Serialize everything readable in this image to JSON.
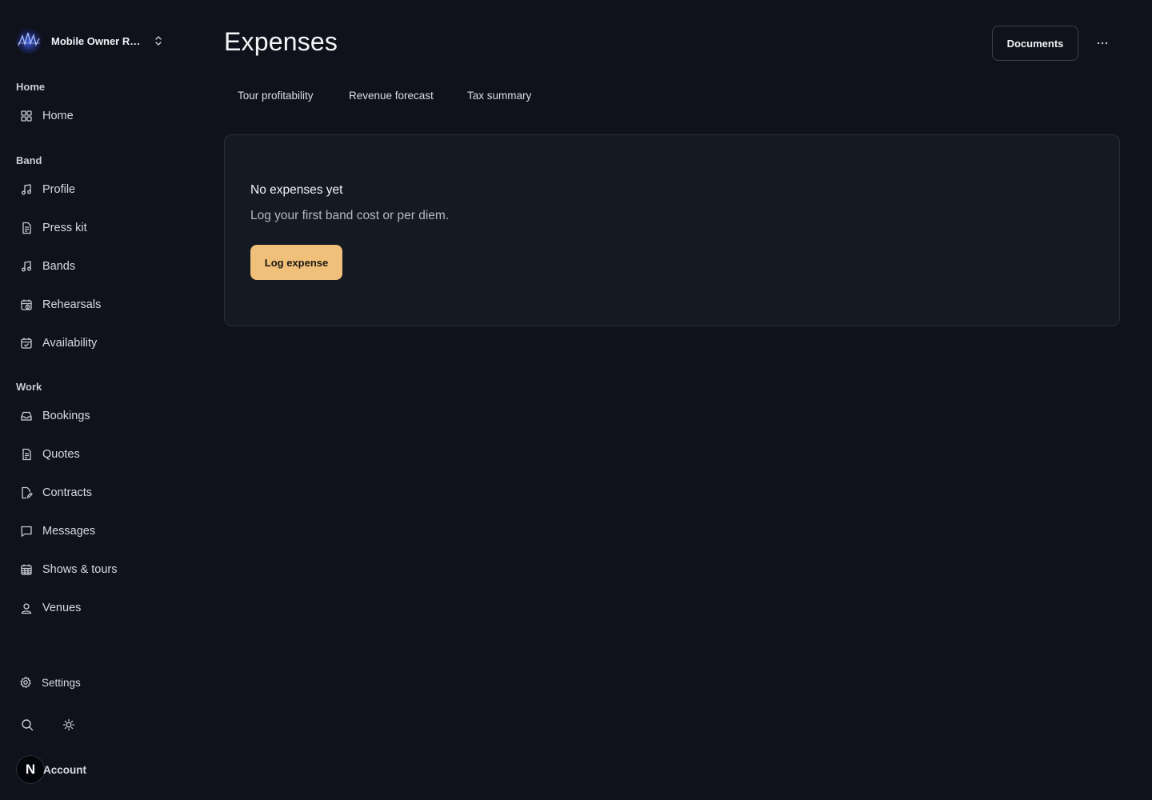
{
  "sidebar": {
    "org_name": "Mobile Owner Re…",
    "sections": {
      "home": "Home",
      "band": "Band",
      "work": "Work"
    },
    "items": {
      "home": "Home",
      "profile": "Profile",
      "press_kit": "Press kit",
      "bands": "Bands",
      "rehearsals": "Rehearsals",
      "availability": "Availability",
      "bookings": "Bookings",
      "quotes": "Quotes",
      "contracts": "Contracts",
      "messages": "Messages",
      "shows_tours": "Shows & tours",
      "venues": "Venues"
    },
    "settings_label": "Settings",
    "account_label": "Account",
    "account_initial": "N"
  },
  "header": {
    "title": "Expenses",
    "documents_label": "Documents"
  },
  "tabs": [
    "Tour profitability",
    "Revenue forecast",
    "Tax summary"
  ],
  "empty_state": {
    "title": "No expenses yet",
    "description": "Log your first band cost or per diem.",
    "button_label": "Log expense"
  },
  "colors": {
    "background": "#0f121a",
    "card": "#151922",
    "accent": "#f0c07a"
  },
  "icons": [
    "chevron-updown-icon",
    "grid-icon",
    "music-note-icon",
    "document-icon",
    "calendar-clock-icon",
    "calendar-check-icon",
    "inbox-icon",
    "edit-document-icon",
    "message-icon",
    "calendar-grid-icon",
    "user-pin-icon",
    "gear-icon",
    "search-icon",
    "sun-icon",
    "more-horizontal-icon"
  ]
}
